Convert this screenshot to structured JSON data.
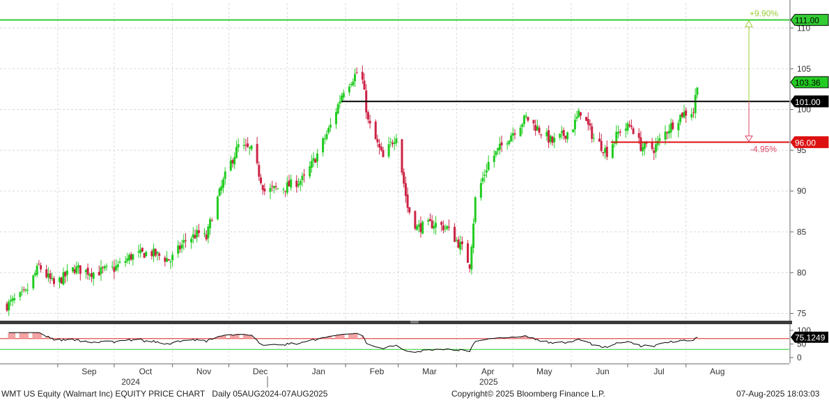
{
  "chart_data": {
    "type": "candlestick",
    "ticker": "WMT US Equity (Walmart Inc)",
    "title": "WMT US Equity (Walmart Inc) EQUITY PRICE CHART",
    "frequency": "Daily",
    "date_range": "05AUG2024-07AUG2025",
    "copyright": "Copyright© 2025 Bloomberg Finance L.P.",
    "timestamp": "07-Aug-2025 18:03:03",
    "price_axis": {
      "ticks": [
        75,
        80,
        85,
        90,
        95,
        100,
        105,
        110
      ],
      "ylim": [
        73,
        115
      ]
    },
    "rsi_axis": {
      "ticks": [
        0,
        50,
        100
      ],
      "ylim": [
        0,
        100
      ]
    },
    "month_labels": [
      "Sep",
      "Oct",
      "Nov",
      "Dec",
      "Jan",
      "Feb",
      "Mar",
      "Apr",
      "May",
      "Jun",
      "Jul",
      "Aug"
    ],
    "year_labels": [
      "2024",
      "2025"
    ],
    "colors": {
      "up": "#22cc22",
      "down": "#cc2244",
      "target": "#33cc33",
      "support": "#dd1111",
      "resistance": "#000000",
      "rsi": "#000000"
    },
    "levels": {
      "target": {
        "value": 111.0,
        "label": "111.00",
        "pct": "+9.90%"
      },
      "resistance": {
        "value": 101.0,
        "label": "101.00"
      },
      "support": {
        "value": 96.0,
        "label": "96.00",
        "pct": "-4.95%"
      },
      "last_price": {
        "value": 103.36,
        "label": "103.36"
      }
    },
    "rsi_last": {
      "value": 75.1249,
      "label": "75.1249"
    },
    "rsi_bands": [
      70,
      30
    ],
    "close_path": [
      [
        "2024-08-05",
        76.0
      ],
      [
        "2024-08-15",
        77.5
      ],
      [
        "2024-08-22",
        80.8
      ],
      [
        "2024-08-30",
        78.5
      ],
      [
        "2024-09-10",
        80.5
      ],
      [
        "2024-09-20",
        80.0
      ],
      [
        "2024-10-01",
        80.5
      ],
      [
        "2024-10-10",
        82.0
      ],
      [
        "2024-10-20",
        82.5
      ],
      [
        "2024-10-31",
        81.5
      ],
      [
        "2024-11-08",
        84.0
      ],
      [
        "2024-11-15",
        84.8
      ],
      [
        "2024-11-19",
        84.2
      ],
      [
        "2024-11-22",
        87.0
      ],
      [
        "2024-11-30",
        92.5
      ],
      [
        "2024-12-06",
        95.5
      ],
      [
        "2024-12-13",
        95.0
      ],
      [
        "2024-12-20",
        90.0
      ],
      [
        "2024-12-31",
        90.5
      ],
      [
        "2025-01-10",
        91.5
      ],
      [
        "2025-01-17",
        94.5
      ],
      [
        "2025-01-24",
        98.0
      ],
      [
        "2025-01-31",
        102.5
      ],
      [
        "2025-02-07",
        104.5
      ],
      [
        "2025-02-10",
        103.5
      ],
      [
        "2025-02-13",
        98.5
      ],
      [
        "2025-02-21",
        94.0
      ],
      [
        "2025-02-28",
        97.0
      ],
      [
        "2025-03-06",
        88.0
      ],
      [
        "2025-03-11",
        85.5
      ],
      [
        "2025-03-20",
        86.0
      ],
      [
        "2025-03-27",
        85.5
      ],
      [
        "2025-04-04",
        83.0
      ],
      [
        "2025-04-08",
        81.0
      ],
      [
        "2025-04-11",
        89.0
      ],
      [
        "2025-04-18",
        93.5
      ],
      [
        "2025-04-30",
        97.0
      ],
      [
        "2025-05-08",
        99.0
      ],
      [
        "2025-05-15",
        97.5
      ],
      [
        "2025-05-22",
        96.0
      ],
      [
        "2025-06-01",
        97.5
      ],
      [
        "2025-06-06",
        99.8
      ],
      [
        "2025-06-13",
        96.5
      ],
      [
        "2025-06-20",
        94.8
      ],
      [
        "2025-06-27",
        97.5
      ],
      [
        "2025-07-03",
        98.0
      ],
      [
        "2025-07-08",
        95.5
      ],
      [
        "2025-07-15",
        95.2
      ],
      [
        "2025-07-22",
        97.5
      ],
      [
        "2025-07-30",
        99.5
      ],
      [
        "2025-08-05",
        99.8
      ],
      [
        "2025-08-07",
        103.36
      ]
    ]
  }
}
